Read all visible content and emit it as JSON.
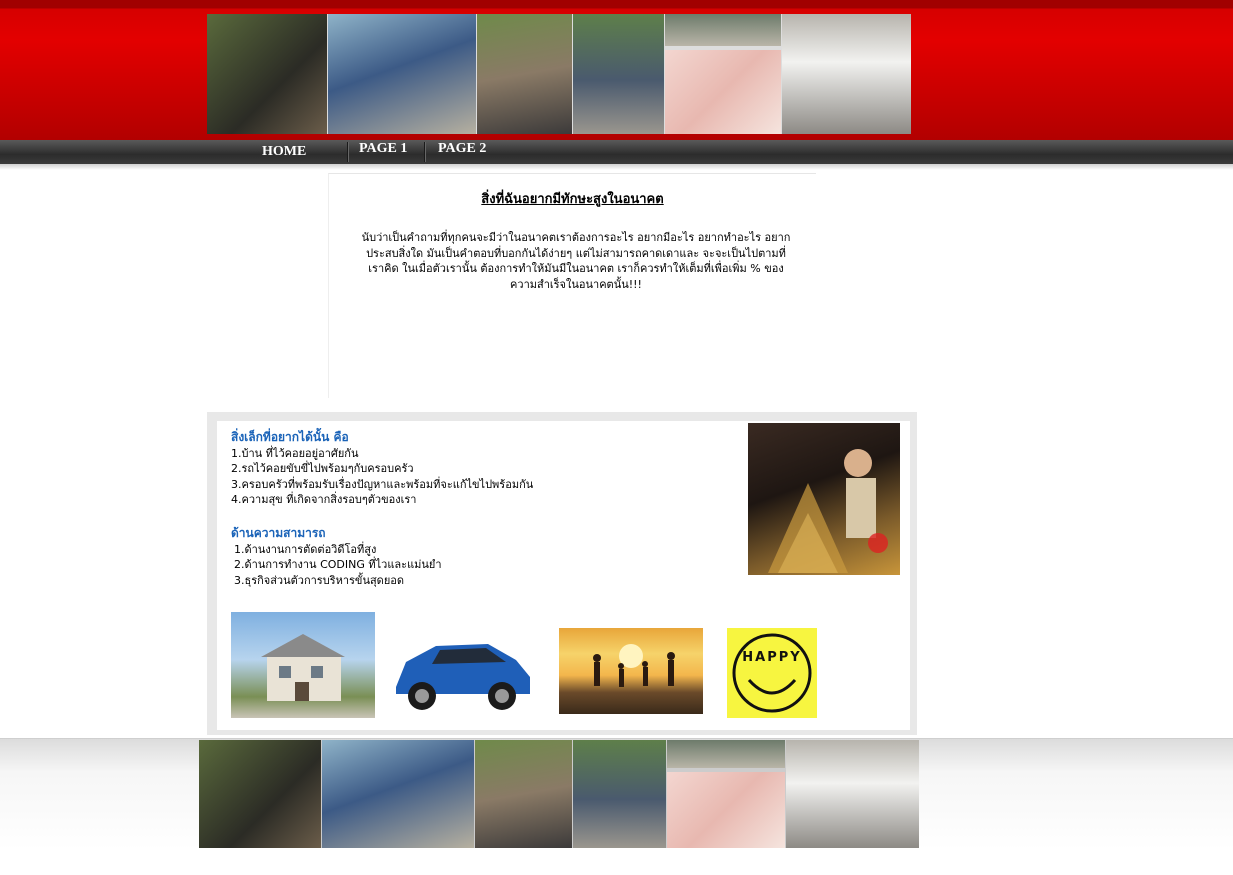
{
  "nav": {
    "home": "HOME",
    "page1": "PAGE 1",
    "page2": "PAGE 2"
  },
  "intro": {
    "title": "สิ่งที่ฉันอยากมีทักษะสูงในอนาคต",
    "body": "นับว่าเป็นคำถามที่ทุกคนจะมีว่าในอนาคตเราต้องการอะไร อยากมีอะไร อยากทำอะไร อยากประสบสิ่งใด  มันเป็นคำตอบที่บอกกันได้ง่ายๆ แต่ไม่สามารถคาดเดาและ จะจะเป็นไปตามที่เราคิด ในเมื่อตัวเรานั้น ต้องการทำให้มันมีในอนาคต เราก็ควรทำให้เต็มที่เพื่อเพิ่ม % ของความสำเร็จในอนาคตนั้น!!!"
  },
  "wishes": {
    "title": "สิ่งเล็กที่อยากได้นั้น คือ",
    "items": [
      "1.บ้าน ที่ไว้คอยอยู่อาศัยกัน",
      "2.รถไว้คอยขับขี่ไปพร้อมๆกับครอบครัว",
      "3.ครอบครัวที่พร้อมรับเรื่องปัญหาและพร้อมที่จะแก้ไขไปพร้อมกัน",
      "4.ความสุข ที่เกิดจากสิ่งรอบๆตัวของเรา"
    ]
  },
  "skills": {
    "title": "ด้านความสามารถ",
    "items": [
      "1.ด้านงานการตัดต่อวิดีโอที่สูง",
      "2.ด้านการทำงาน CODING ที่ไวและแม่นยำ",
      "3.ธุรกิจส่วนตัวการบริหารขั้นสุดยอด"
    ]
  },
  "happy_sign": "HAPPY",
  "colors": {
    "header_red": "#d60000",
    "nav_dark": "#333333",
    "section_title_blue": "#1a63b8"
  }
}
